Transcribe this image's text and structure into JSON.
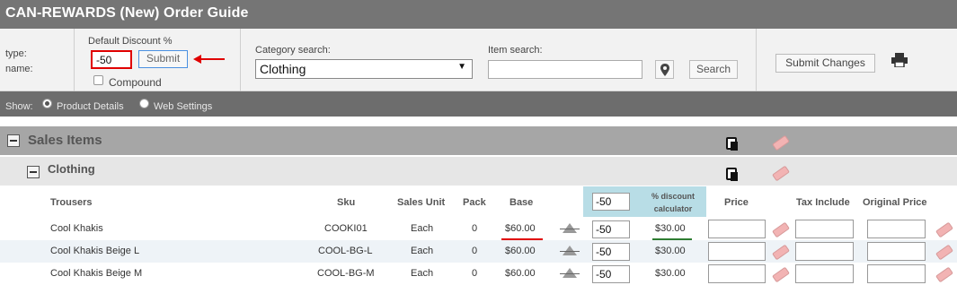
{
  "header": {
    "title": "CAN-REWARDS (New) Order Guide"
  },
  "customer": {
    "type_label": "type:",
    "name_label": "name:"
  },
  "discount": {
    "label": "Default Discount %",
    "value": "-50",
    "submit_label": "Submit",
    "compound_label": "Compound"
  },
  "category_search": {
    "label": "Category search:",
    "selected": "Clothing"
  },
  "item_search": {
    "label": "Item search:",
    "value": "",
    "search_label": "Search"
  },
  "actions": {
    "submit_changes_label": "Submit Changes"
  },
  "show": {
    "label": "Show:",
    "options": [
      "Product Details",
      "Web Settings"
    ],
    "selected": "Product Details"
  },
  "sections": {
    "sales_items": "Sales Items",
    "group": "Clothing"
  },
  "table": {
    "columns": {
      "product": "Trousers",
      "sku": "Sku",
      "sales_unit": "Sales Unit",
      "pack": "Pack",
      "base": "Base",
      "discount_value": "-50",
      "discount_calc": "% discount calculator",
      "price": "Price",
      "tax_include": "Tax Include",
      "original_price": "Original Price"
    },
    "rows": [
      {
        "name": "Cool Khakis",
        "sku": "COOKI01",
        "unit": "Each",
        "pack": "0",
        "base": "$60.00",
        "discount": "-50",
        "calc": "$30.00"
      },
      {
        "name": "Cool Khakis Beige L",
        "sku": "COOL-BG-L",
        "unit": "Each",
        "pack": "0",
        "base": "$60.00",
        "discount": "-50",
        "calc": "$30.00"
      },
      {
        "name": "Cool Khakis Beige M",
        "sku": "COOL-BG-M",
        "unit": "Each",
        "pack": "0",
        "base": "$60.00",
        "discount": "-50",
        "calc": "$30.00"
      }
    ]
  },
  "colors": {
    "annotation_red": "#e00000",
    "annotation_green": "#2e7d32",
    "calc_header": "#b8dde6"
  },
  "icons": [
    "location-pin-icon",
    "printer-icon",
    "copy-icon",
    "eraser-icon",
    "triangle-apply-icon",
    "collapse-icon",
    "red-arrow-icon"
  ]
}
